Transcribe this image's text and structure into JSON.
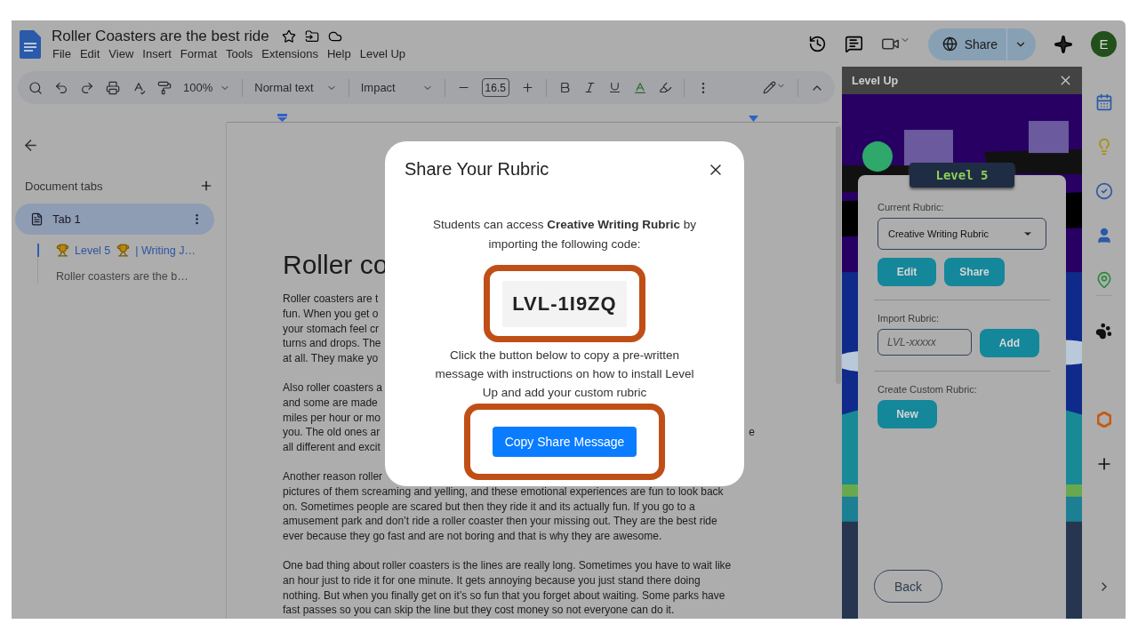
{
  "document_title": "Roller Coasters are the best ride",
  "menu": [
    "File",
    "Edit",
    "View",
    "Insert",
    "Format",
    "Tools",
    "Extensions",
    "Help",
    "Level Up"
  ],
  "header": {
    "share_label": "Share",
    "avatar": "E"
  },
  "toolbar": {
    "zoom": "100%",
    "style": "Normal text",
    "font": "Impact",
    "font_size": "16.5"
  },
  "sidebar": {
    "heading": "Document tabs",
    "tabs": [
      {
        "label": "Tab 1",
        "selected": true,
        "children": [
          {
            "kind": "heading",
            "parts": [
              "Level 5",
              "| Writing J…"
            ],
            "selected": true
          },
          {
            "kind": "paragraph",
            "parts": [
              "Roller coasters are the b…"
            ],
            "selected": false
          }
        ]
      }
    ]
  },
  "document": {
    "title": "Roller co",
    "paragraphs": [
      {
        "lines": [
          {
            "text": "Roller coasters are t"
          },
          {
            "text": "fun. When you get o"
          },
          {
            "text": "your stomach feel cr"
          },
          {
            "text": "turns and drops. The"
          },
          {
            "text": "at all. They make yo"
          }
        ]
      },
      {
        "lines": [
          {
            "text": "Also roller coasters a"
          },
          {
            "text": "and some are made"
          },
          {
            "text": "miles per hour or mo"
          },
          {
            "text": "you. The old ones ar",
            "tail": "e"
          },
          {
            "text": "all different and excit"
          }
        ]
      },
      {
        "lines": [
          {
            "text": "Another reason roller"
          },
          {
            "text": "pictures of them screaming and yelling, and these emotional experiences are fun to look back"
          },
          {
            "text": "on. Sometimes people are scared but then they ride it and its actually fun. If you go to a"
          },
          {
            "text": "amusement park and don’t ride a roller coaster then your missing out. They are the best ride"
          },
          {
            "text": "ever because they go fast and are not boring and that is why they are awesome."
          }
        ]
      },
      {
        "lines": [
          {
            "text": "One bad thing about roller coasters is the lines are really long. Sometimes you have to wait like"
          },
          {
            "text": "an hour just to ride it for one minute. It gets annoying because you just stand there doing"
          },
          {
            "text": "nothing. But when you finally get on it’s so fun that you forget about waiting. Some parks have"
          },
          {
            "text": "fast passes so you can skip the line but they cost money so not everyone can do it."
          }
        ]
      }
    ]
  },
  "dialog": {
    "title": "Share Your Rubric",
    "intro": "Students can access **Creative Writing Rubric** by importing the following code:",
    "code": {
      "text": "LVL-1I9ZQ",
      "highlighted": true
    },
    "instructions": "Click the button below to copy a pre-written message with instructions on how to install Level Up and add your custom rubric",
    "button": {
      "label": "Copy Share Message",
      "highlighted": true
    }
  },
  "addon": {
    "title": "Level Up",
    "badge": "Level 5",
    "current_label": "Current Rubric:",
    "current_value": "Creative Writing Rubric",
    "actions": [
      "Edit",
      "Share"
    ],
    "import_label": "Import Rubric:",
    "import_placeholder": "LVL-xxxxx",
    "import_button": "Add",
    "create_label": "Create Custom Rubric:",
    "create_button": "New",
    "back_button": "Back"
  }
}
